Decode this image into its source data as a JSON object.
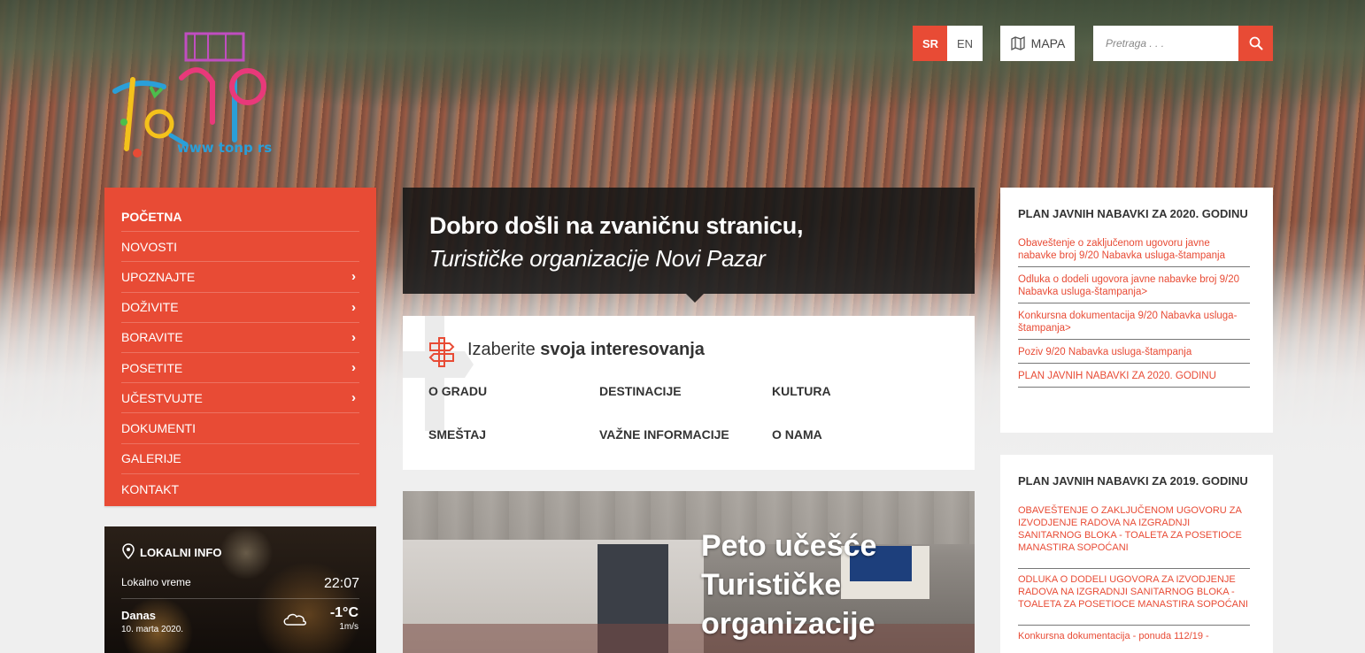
{
  "logo": {
    "url_text": "www tonp rs"
  },
  "top": {
    "lang_sr": "SR",
    "lang_en": "EN",
    "map_label": "MAPA",
    "search_placeholder": "Pretraga . . ."
  },
  "menu": {
    "items": [
      {
        "label": "POČETNA",
        "has_arrow": false
      },
      {
        "label": "NOVOSTI",
        "has_arrow": false
      },
      {
        "label": "UPOZNAJTE",
        "has_arrow": true
      },
      {
        "label": "DOŽIVITE",
        "has_arrow": true
      },
      {
        "label": "BORAVITE",
        "has_arrow": true
      },
      {
        "label": "POSETITE",
        "has_arrow": true
      },
      {
        "label": "UČESTVUJTE",
        "has_arrow": true
      },
      {
        "label": "DOKUMENTI",
        "has_arrow": false
      },
      {
        "label": "GALERIJE",
        "has_arrow": false
      },
      {
        "label": "KONTAKT",
        "has_arrow": false
      }
    ],
    "arrow": "›"
  },
  "info": {
    "title": "LOKALNI INFO",
    "time_label": "Lokalno vreme",
    "time_value": "22:07",
    "today_label": "Danas",
    "date": "10. marta 2020.",
    "temperature": "-1°C",
    "wind": "1m/s"
  },
  "welcome": {
    "line1": "Dobro došli na zvaničnu stranicu,",
    "line2": "Turističke organizacije Novi Pazar"
  },
  "interests": {
    "title_normal": "Izaberite ",
    "title_bold": "svoja interesovanja",
    "links": [
      "O GRADU",
      "DESTINACIJE",
      "KULTURA",
      "SMEŠTAJ",
      "VAŽNE INFORMACIJE",
      "O NAMA"
    ]
  },
  "news": {
    "title": "Peto učešće Turističke organizacije"
  },
  "plan2020": {
    "title": "PLAN JAVNIH NABAVKI ZA 2020. GODINU",
    "links": [
      "Obaveštenje o zaključenom ugovoru javne nabavke broj 9/20 Nabavka usluga-štampanja",
      "Odluka o dodeli ugovora javne nabavke broj 9/20 Nabavka usluga-štampanja>",
      "Konkursna dokumentacija 9/20 Nabavka usluga-štampanja>",
      "Poziv 9/20 Nabavka usluga-štampanja",
      "PLAN JAVNIH NABAVKI ZA 2020. GODINU"
    ]
  },
  "plan2019": {
    "title": "PLAN JAVNIH NABAVKI ZA 2019. GODINU",
    "links": [
      "OBAVEŠTENJE O ZAKLJUČENOM UGOVORU ZA IZVODJENJE RADOVA NA IZGRADNJI SANITARNOG BLOKA - TOALETA ZA POSETIOCE MANASTIRA SOPOĆANI",
      "ODLUKA O DODELI UGOVORA ZA IZVODJENJE RADOVA NA IZGRADNJI SANITARNOG BLOKA - TOALETA ZA POSETIOCE MANASTIRA SOPOĆANI",
      "Konkursna dokumentacija - ponuda 112/19 -"
    ]
  },
  "colors": {
    "accent": "#e84b35",
    "dark_banner": "#141414",
    "link": "#e84b35"
  }
}
